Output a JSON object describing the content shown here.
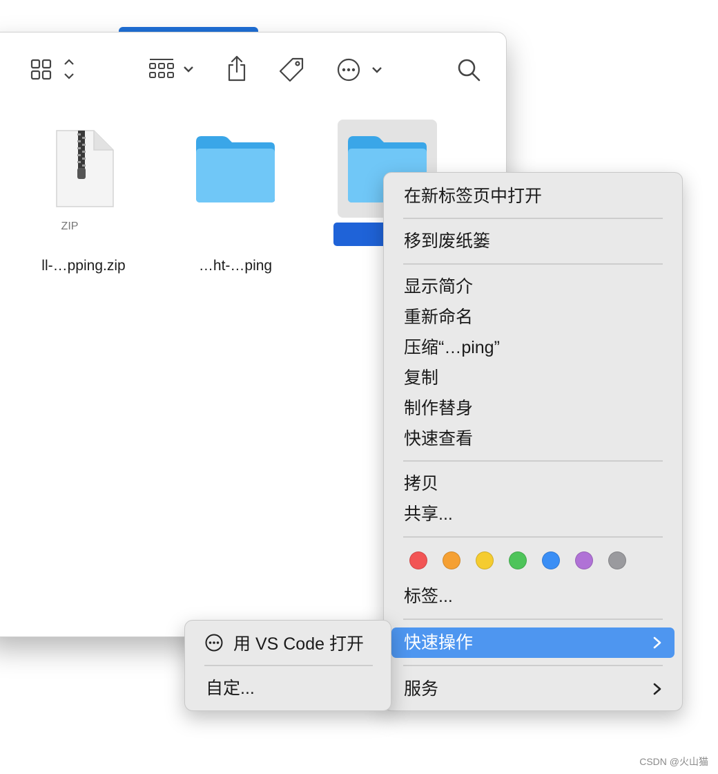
{
  "files": [
    {
      "kind": "zip",
      "badge": "ZIP",
      "name": "ll-…pping.zip"
    },
    {
      "kind": "folder",
      "name": "…ht-…ping"
    },
    {
      "kind": "folder",
      "name": "",
      "selected": true
    }
  ],
  "context_menu": {
    "items": [
      {
        "label": "在新标签页中打开"
      },
      {
        "label": "移到废纸篓"
      },
      {
        "label": "显示简介"
      },
      {
        "label": "重新命名"
      },
      {
        "label": "压缩“…ping”"
      },
      {
        "label": "复制"
      },
      {
        "label": "制作替身"
      },
      {
        "label": "快速查看"
      },
      {
        "label": "拷贝"
      },
      {
        "label": "共享..."
      },
      {
        "label": "标签..."
      },
      {
        "label": "快速操作"
      },
      {
        "label": "服务"
      }
    ],
    "tag_colors": [
      "#f25555",
      "#f5a033",
      "#f5cc30",
      "#4ec45a",
      "#3a8ef5",
      "#b072d6",
      "#9a9a9e"
    ],
    "highlight_color": "#4e96f0"
  },
  "submenu": {
    "open_vscode_label": "用 VS Code 打开",
    "customize_label": "自定..."
  },
  "watermark": "CSDN @火山猫"
}
